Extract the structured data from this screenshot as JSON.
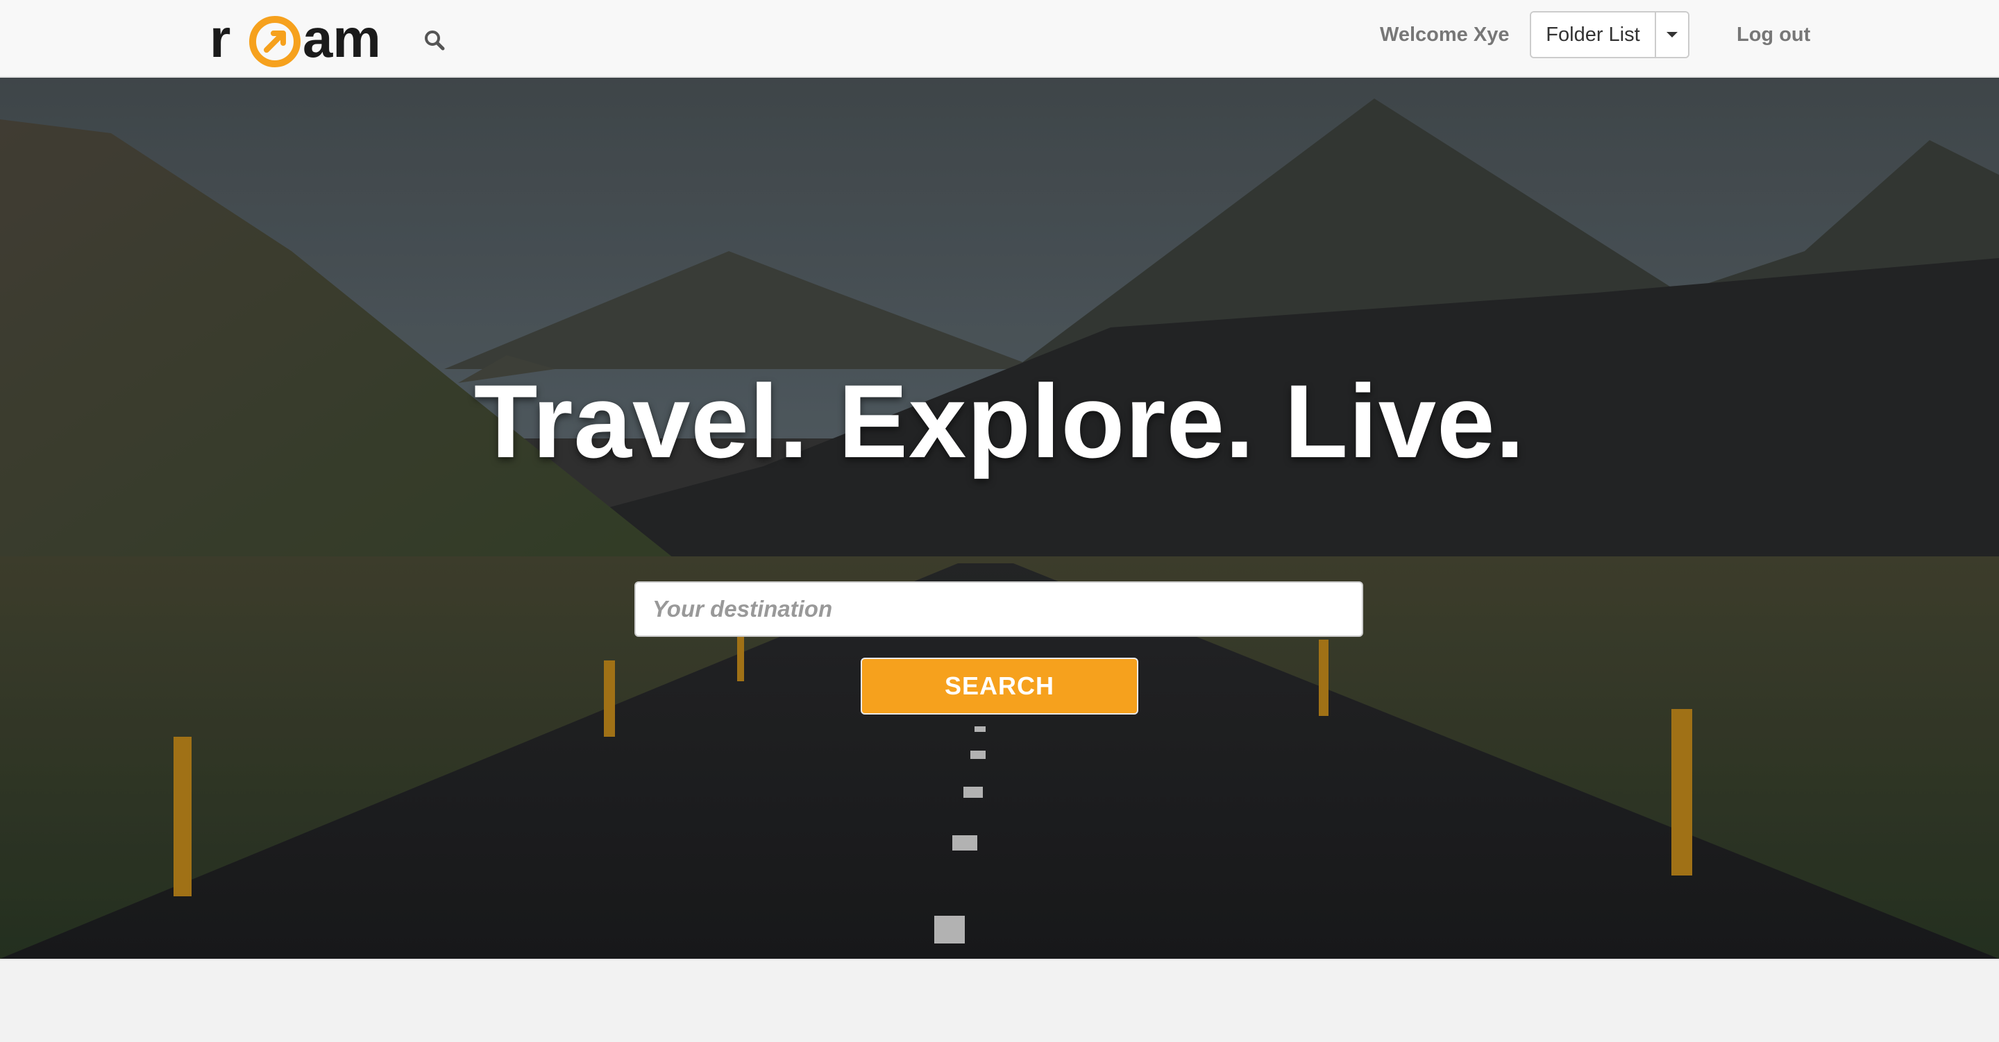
{
  "brand": {
    "name": "roam",
    "logo_letters": [
      "r",
      "am"
    ],
    "accent_color": "#f6a11d",
    "logo_color": "#1b1b1b"
  },
  "nav": {
    "search_icon": "search-icon",
    "welcome_text": "Welcome Xye",
    "folder_button_label": "Folder List",
    "folder_caret_icon": "caret-down-icon",
    "logout_label": "Log out"
  },
  "hero": {
    "title": "Travel. Explore. Live.",
    "destination_placeholder": "Your destination",
    "destination_value": "",
    "search_button_label": "SEARCH",
    "background_description_icon": "landscape-road-mountains"
  },
  "colors": {
    "navbar_bg": "#f8f8f8",
    "nav_text": "#777777",
    "button_orange": "#f6a11d",
    "page_bg": "#f2f2f2"
  }
}
